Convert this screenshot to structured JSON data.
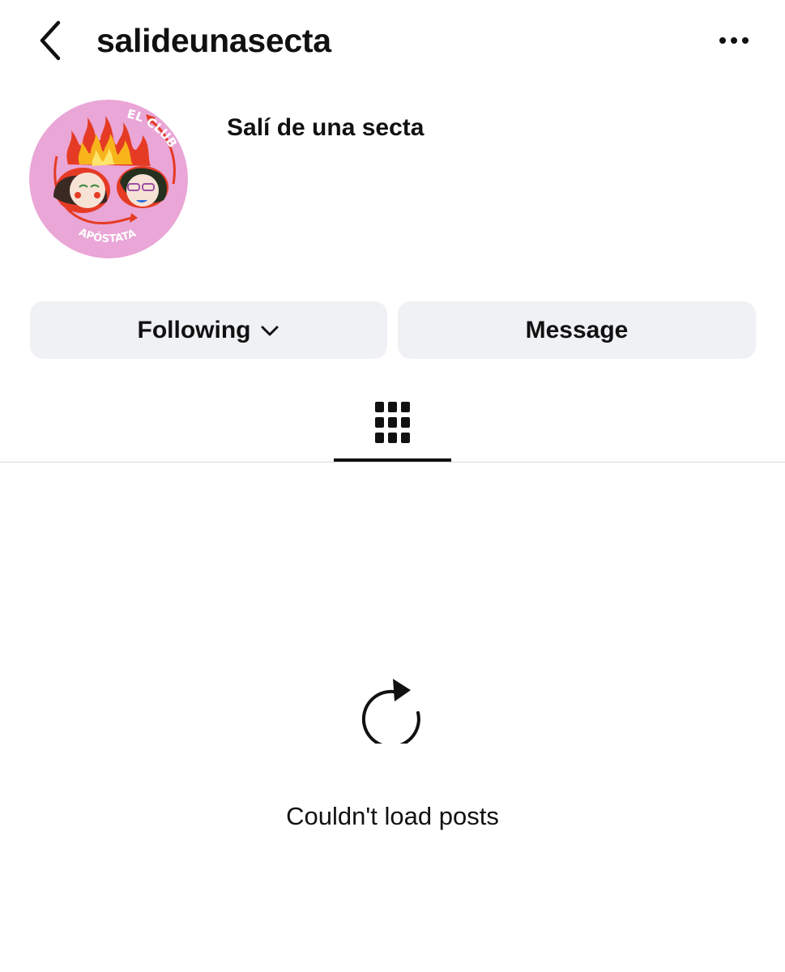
{
  "header": {
    "back_icon": "chevron-left-icon",
    "username": "salideunasecta",
    "more_icon": "more-horizontal-icon"
  },
  "profile": {
    "avatar_text_top": "EL CLUB",
    "avatar_text_bottom": "APÓSTATA",
    "display_name": "Salí de una secta"
  },
  "actions": {
    "following_label": "Following",
    "following_icon": "chevron-down-icon",
    "message_label": "Message"
  },
  "tabs": {
    "grid_icon": "grid-icon",
    "active": "grid"
  },
  "posts": {
    "reload_icon": "reload-icon",
    "error_message": "Couldn't load posts"
  },
  "colors": {
    "button_bg": "#eff1f4",
    "avatar_bg": "#e9a6d6",
    "accent_red": "#e53b24",
    "text": "#111111"
  }
}
